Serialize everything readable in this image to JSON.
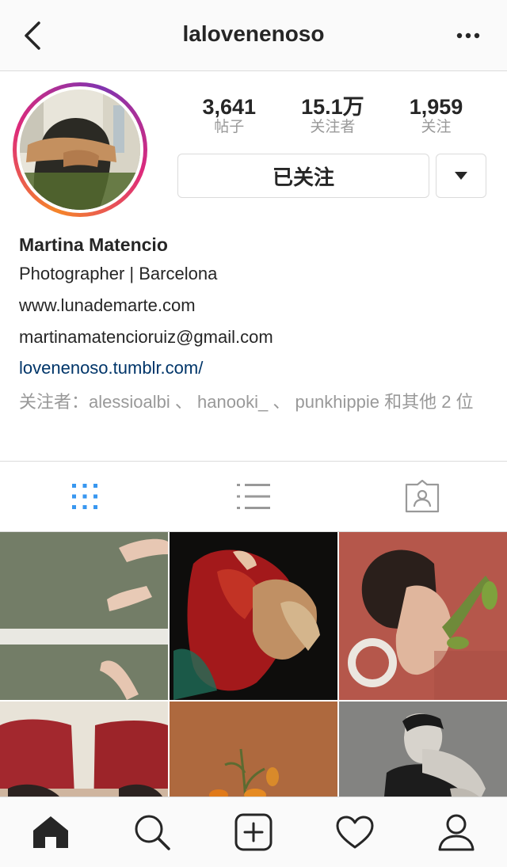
{
  "header": {
    "username": "lalovenenoso",
    "back_icon": "chevron-left-icon",
    "more_icon": "more-horizontal-icon"
  },
  "profile": {
    "stats": [
      {
        "value": "3,641",
        "label": "帖子"
      },
      {
        "value": "15.1万",
        "label": "关注者"
      },
      {
        "value": "1,959",
        "label": "关注"
      }
    ],
    "follow_button_label": "已关注",
    "dropdown_icon": "caret-down-icon"
  },
  "bio": {
    "name": "Martina Matencio",
    "description": "Photographer | Barcelona",
    "website": "www.lunademarte.com",
    "email": "martinamatencioruiz@gmail.com",
    "link": "lovenenoso.tumblr.com/",
    "followed_by_prefix": "关注者：",
    "followed_by_users": [
      "alessioalbi",
      "hanooki_",
      "punkhippie"
    ],
    "followed_by_sep": " 、 ",
    "followed_by_suffix": " 和其他 2 位"
  },
  "tabs": [
    {
      "name": "grid",
      "icon": "grid-icon",
      "active": true
    },
    {
      "name": "list",
      "icon": "list-icon",
      "active": false
    },
    {
      "name": "tagged",
      "icon": "tagged-icon",
      "active": false
    }
  ],
  "bottom_nav": [
    {
      "name": "home",
      "icon": "home-icon"
    },
    {
      "name": "search",
      "icon": "search-icon"
    },
    {
      "name": "new-post",
      "icon": "plus-square-icon"
    },
    {
      "name": "activity",
      "icon": "heart-icon"
    },
    {
      "name": "profile",
      "icon": "user-icon"
    }
  ],
  "colors": {
    "accent_blue": "#3897f0",
    "link_blue": "#003569",
    "muted_gray": "#999999",
    "border": "#dbdbdb"
  }
}
